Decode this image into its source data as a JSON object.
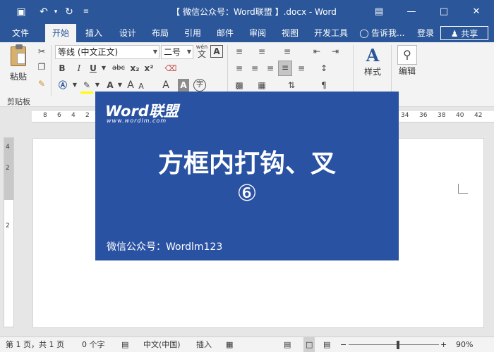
{
  "window": {
    "title": "【 微信公众号：Word联盟 】.docx - Word",
    "save_icon": "save-icon",
    "undo_icon": "undo-icon",
    "redo_icon": "redo-icon",
    "customize_icon": "customize-icon",
    "ribbon_display_icon": "ribbon-display-icon",
    "minimize_icon": "minimize-icon",
    "maximize_icon": "maximize-icon",
    "close_icon": "close-icon",
    "accent_color": "#2b579a"
  },
  "tabs": [
    {
      "label": "文件",
      "active": false
    },
    {
      "label": "开始",
      "active": true
    },
    {
      "label": "插入",
      "active": false
    },
    {
      "label": "设计",
      "active": false
    },
    {
      "label": "布局",
      "active": false
    },
    {
      "label": "引用",
      "active": false
    },
    {
      "label": "邮件",
      "active": false
    },
    {
      "label": "审阅",
      "active": false
    },
    {
      "label": "视图",
      "active": false
    },
    {
      "label": "开发工具",
      "active": false
    }
  ],
  "tell_me": "告诉我...",
  "signin": "登录",
  "share": "共享",
  "ribbon": {
    "paste_label": "粘贴",
    "clipboard_group": "剪贴板",
    "font_name": "等线 (中文正文)",
    "font_size": "二号",
    "phonetic_label": "wén",
    "phonetic_char": "文",
    "border_char": "A",
    "bold": "B",
    "italic": "I",
    "underline": "U",
    "strikethrough": "abc",
    "subscript": "x₂",
    "superscript": "x²",
    "grow_font": "A",
    "shrink_font": "A",
    "char_shading": "A",
    "enclose_char": "字",
    "styles_label": "样式",
    "editing_label": "编辑"
  },
  "ruler": {
    "h_numbers": [
      "8",
      "6",
      "4",
      "2",
      "34",
      "36",
      "38",
      "40",
      "42"
    ],
    "v_numbers": [
      "4",
      "2",
      "2"
    ]
  },
  "card": {
    "brand": "Word联盟",
    "brand_sub": "www.wordlm.com",
    "headline": "方框内打钩、叉",
    "headline_num": "⑥",
    "footer": "微信公众号：Wordlm123",
    "background_color": "#2a52a3"
  },
  "status": {
    "page": "第 1 页，共 1 页",
    "words": "0 个字",
    "language": "中文(中国)",
    "mode": "插入",
    "zoom": "90%"
  }
}
